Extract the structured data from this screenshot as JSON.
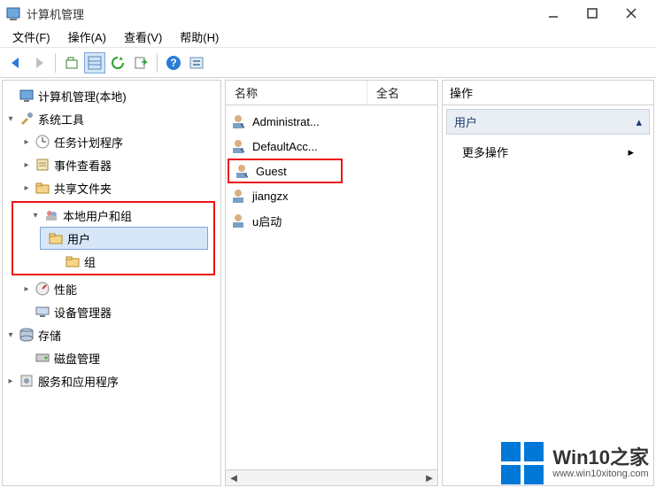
{
  "window": {
    "title": "计算机管理"
  },
  "menu": {
    "file": "文件(F)",
    "action": "操作(A)",
    "view": "查看(V)",
    "help": "帮助(H)"
  },
  "tree": {
    "root": "计算机管理(本地)",
    "system_tools": "系统工具",
    "task_scheduler": "任务计划程序",
    "event_viewer": "事件查看器",
    "shared_folders": "共享文件夹",
    "local_users": "本地用户和组",
    "users": "用户",
    "groups": "组",
    "performance": "性能",
    "device_manager": "设备管理器",
    "storage": "存储",
    "disk_management": "磁盘管理",
    "services_apps": "服务和应用程序"
  },
  "list": {
    "col_name": "名称",
    "col_fullname": "全名",
    "items": {
      "0": "Administrat...",
      "1": "DefaultAcc...",
      "2": "Guest",
      "3": "jiangzx",
      "4": "u启动"
    }
  },
  "actions": {
    "header": "操作",
    "section": "用户",
    "more": "更多操作"
  },
  "watermark": {
    "brand": "Win10之家",
    "url": "www.win10xitong.com"
  }
}
